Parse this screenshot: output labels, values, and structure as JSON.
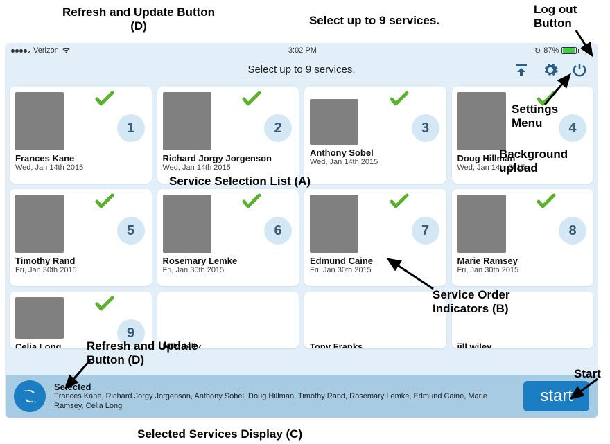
{
  "statusbar": {
    "carrier": "Verizon",
    "time": "3:02 PM",
    "battery_pct": "87%"
  },
  "header": {
    "title": "Select up to 9 services.",
    "icons": {
      "upload": "upload-icon",
      "settings": "gear-icon",
      "power": "power-icon"
    }
  },
  "services": [
    {
      "name": "Frances Kane",
      "date": "Wed, Jan 14th 2015",
      "order": "1",
      "selected": true,
      "photo": "ph1"
    },
    {
      "name": "Richard Jorgy Jorgenson",
      "date": "Wed, Jan 14th 2015",
      "order": "2",
      "selected": true,
      "photo": "ph2"
    },
    {
      "name": "Anthony  Sobel",
      "date": "Wed, Jan 14th 2015",
      "order": "3",
      "selected": true,
      "photo": "ph3",
      "photo_shape": "sq"
    },
    {
      "name": "Doug Hillman",
      "date": "Wed, Jan 14th 2015",
      "order": "4",
      "selected": true,
      "photo": "ph4"
    },
    {
      "name": "Timothy Rand",
      "date": "Fri, Jan 30th 2015",
      "order": "5",
      "selected": true,
      "photo": "ph5"
    },
    {
      "name": "Rosemary Lemke",
      "date": "Fri, Jan 30th 2015",
      "order": "6",
      "selected": true,
      "photo": "ph6"
    },
    {
      "name": "Edmund Caine",
      "date": "Fri, Jan 30th 2015",
      "order": "7",
      "selected": true,
      "photo": "ph7"
    },
    {
      "name": "Marie Ramsey",
      "date": "Fri, Jan 30th 2015",
      "order": "8",
      "selected": true,
      "photo": "ph8"
    },
    {
      "name": "Celia Long",
      "date": "Fri, Jan 30th 2015",
      "order": "9",
      "selected": true,
      "photo": "ph9",
      "cropped": true
    },
    {
      "name": "billy billy",
      "date": "",
      "order": "",
      "selected": false,
      "photo": "",
      "cropped": true
    },
    {
      "name": "Tony Franks",
      "date": "",
      "order": "",
      "selected": false,
      "photo": "",
      "cropped": true
    },
    {
      "name": "jill wiley",
      "date": "",
      "order": "",
      "selected": false,
      "photo": "",
      "cropped": true
    }
  ],
  "footer": {
    "selected_label": "Selected",
    "selected_names": "Frances Kane, Richard Jorgy Jorgenson, Anthony  Sobel, Doug Hillman, Timothy Rand, Rosemary Lemke, Edmund Caine, Marie Ramsey, Celia Long",
    "start_label": "start"
  },
  "annotations": {
    "refresh_and_update_1": "Refresh and Update Button",
    "refresh_and_update_2": "(D)",
    "refresh_and_update_3": "Refresh and Update",
    "refresh_and_update_4": "Button (D)",
    "selection_title": "Select up to 9 services.",
    "service_selection": "Service Selection List (A)",
    "service_order_1": "Service Order",
    "service_order_2": "Indicators (B)",
    "selected_services": "Selected Services Display (C)",
    "settings_1": "Settings",
    "settings_2": "Menu",
    "background_1": "Background",
    "background_2": "upload",
    "start_1": "Start",
    "logout_1": "Log out",
    "logout_2": "Button"
  }
}
